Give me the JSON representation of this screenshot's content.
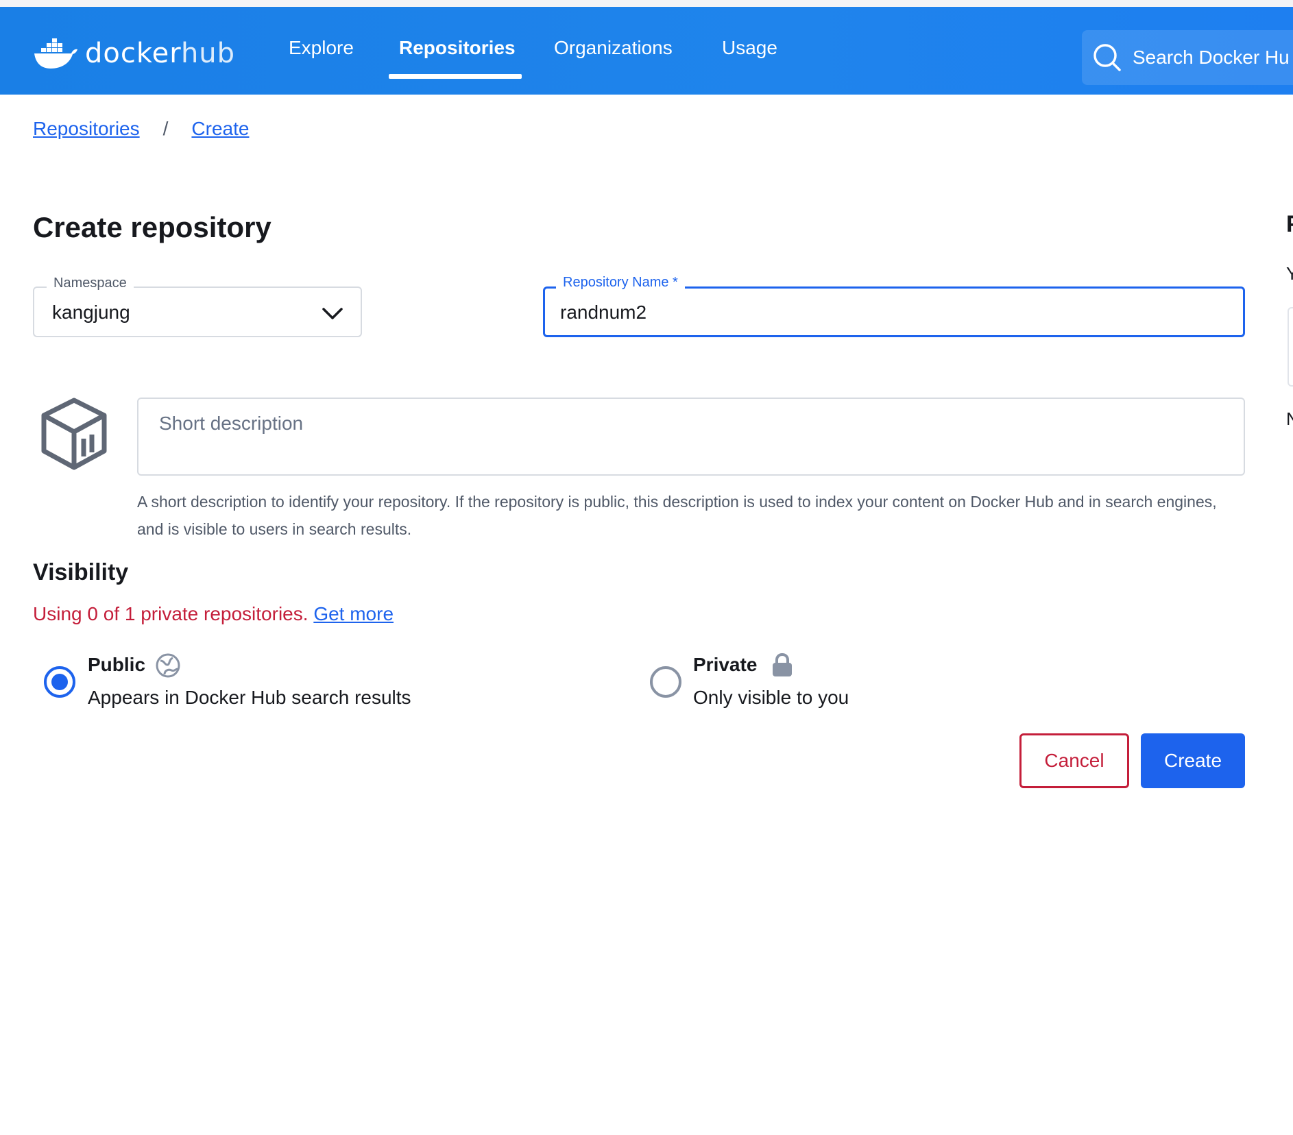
{
  "brand": {
    "logo_primary": "docker",
    "logo_secondary": "hub",
    "accent_color": "#1d63ed",
    "nav_color": "#1f84ec",
    "danger_color": "#c41e3a"
  },
  "nav": {
    "items": [
      {
        "label": "Explore",
        "active": false
      },
      {
        "label": "Repositories",
        "active": true
      },
      {
        "label": "Organizations",
        "active": false
      },
      {
        "label": "Usage",
        "active": false
      }
    ],
    "search_placeholder": "Search Docker Hu"
  },
  "breadcrumb": {
    "items": [
      "Repositories",
      "Create"
    ],
    "separator": "/"
  },
  "page": {
    "title": "Create repository"
  },
  "form": {
    "namespace": {
      "label": "Namespace",
      "value": "kangjung"
    },
    "repository_name": {
      "label": "Repository Name *",
      "value": "randnum2"
    },
    "description": {
      "placeholder": "Short description",
      "value": "",
      "help": "A short description to identify your repository. If the repository is public, this description is used to index your content on Docker Hub and in search engines, and is visible to users in search results."
    }
  },
  "visibility": {
    "title": "Visibility",
    "usage_text": "Using 0 of 1 private repositories.",
    "usage_link": "Get more",
    "options": [
      {
        "title": "Public",
        "description": "Appears in Docker Hub search results",
        "icon": "globe-icon",
        "selected": true
      },
      {
        "title": "Private",
        "description": "Only visible to you",
        "icon": "lock-icon",
        "selected": false
      }
    ]
  },
  "actions": {
    "cancel_label": "Cancel",
    "create_label": "Create"
  },
  "side_panel_clipped": {
    "heading_fragment": "P",
    "line1_fragment": "Y",
    "line2_fragment": "N"
  }
}
